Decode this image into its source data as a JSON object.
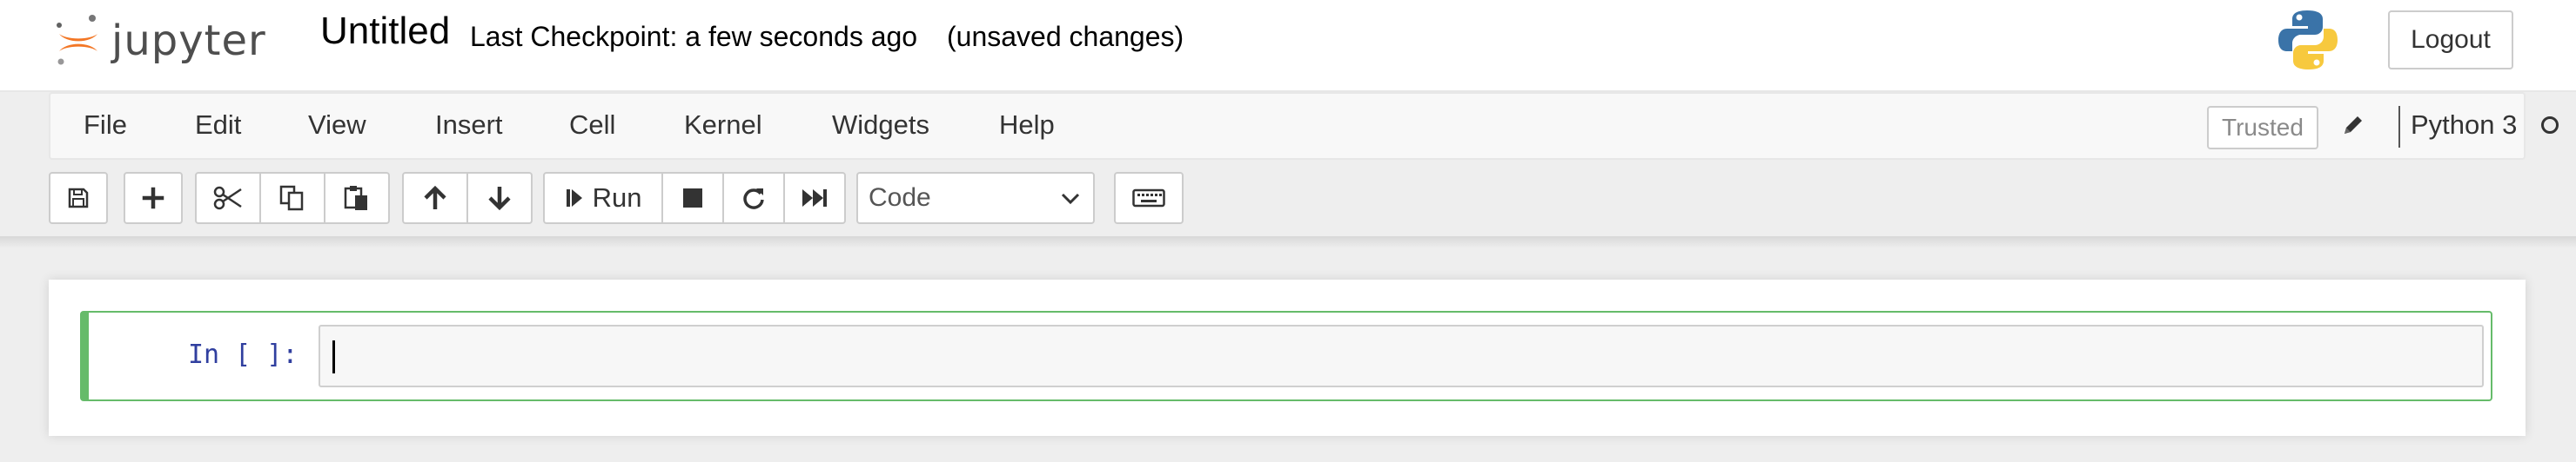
{
  "header": {
    "logo_text": "jupyter",
    "notebook_title": "Untitled",
    "checkpoint": "Last Checkpoint: a few seconds ago",
    "unsaved": "(unsaved changes)",
    "logout_label": "Logout"
  },
  "menubar": {
    "items": [
      "File",
      "Edit",
      "View",
      "Insert",
      "Cell",
      "Kernel",
      "Widgets",
      "Help"
    ],
    "trusted_label": "Trusted",
    "kernel_name": "Python 3"
  },
  "toolbar": {
    "run_label": "Run",
    "cell_type": "Code",
    "icons": [
      "save-icon",
      "plus-icon",
      "scissors-icon",
      "copy-icon",
      "paste-icon",
      "arrow-up-icon",
      "arrow-down-icon",
      "step-forward-icon",
      "stop-icon",
      "refresh-icon",
      "fast-forward-icon",
      "keyboard-icon"
    ]
  },
  "cell": {
    "prompt": "In [ ]:",
    "source": ""
  },
  "colors": {
    "cell_border": "#66bb6a",
    "prompt": "#303f9f",
    "jupyter_orange": "#f37726"
  }
}
